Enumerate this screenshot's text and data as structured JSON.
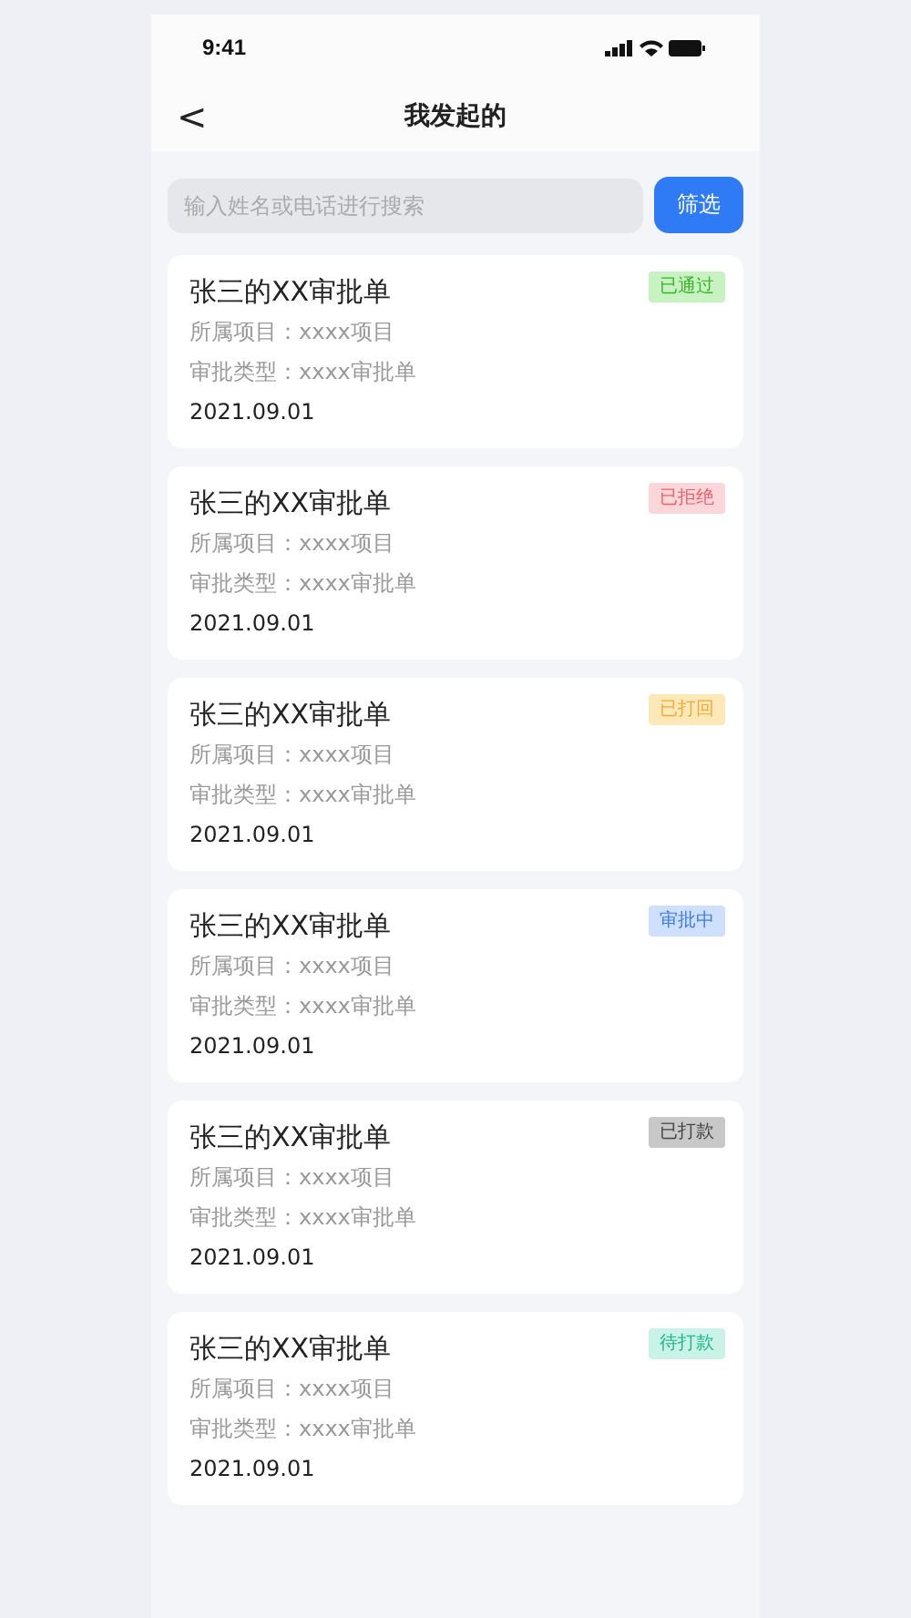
{
  "status_bar": {
    "time": "9:41"
  },
  "nav": {
    "back": "<",
    "title": "我发起的"
  },
  "search": {
    "placeholder": "输入姓名或电话进行搜索",
    "button": "筛选"
  },
  "items": [
    {
      "title": "张三的XX审批单",
      "project": "所属项目：xxxx项目",
      "type": "审批类型：xxxx审批单",
      "date": "2021.09.01",
      "status": "已通过",
      "kind": "approved"
    },
    {
      "title": "张三的XX审批单",
      "project": "所属项目：xxxx项目",
      "type": "审批类型：xxxx审批单",
      "date": "2021.09.01",
      "status": "已拒绝",
      "kind": "rejected"
    },
    {
      "title": "张三的XX审批单",
      "project": "所属项目：xxxx项目",
      "type": "审批类型：xxxx审批单",
      "date": "2021.09.01",
      "status": "已打回",
      "kind": "returned"
    },
    {
      "title": "张三的XX审批单",
      "project": "所属项目：xxxx项目",
      "type": "审批类型：xxxx审批单",
      "date": "2021.09.01",
      "status": "审批中",
      "kind": "reviewing"
    },
    {
      "title": "张三的XX审批单",
      "project": "所属项目：xxxx项目",
      "type": "审批类型：xxxx审批单",
      "date": "2021.09.01",
      "status": "已打款",
      "kind": "paid"
    },
    {
      "title": "张三的XX审批单",
      "project": "所属项目：xxxx项目",
      "type": "审批类型：xxxx审批单",
      "date": "2021.09.01",
      "status": "待打款",
      "kind": "pending"
    }
  ]
}
